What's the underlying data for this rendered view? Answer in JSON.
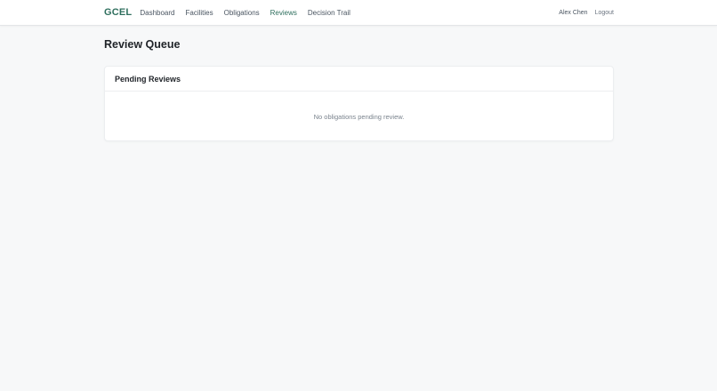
{
  "nav": {
    "brand": "GCEL",
    "links": [
      {
        "label": "Dashboard",
        "active": false
      },
      {
        "label": "Facilities",
        "active": false
      },
      {
        "label": "Obligations",
        "active": false
      },
      {
        "label": "Reviews",
        "active": true
      },
      {
        "label": "Decision Trail",
        "active": false
      }
    ],
    "user_name": "Alex Chen",
    "logout_label": "Logout"
  },
  "page": {
    "title": "Review Queue"
  },
  "pending_card": {
    "title": "Pending Reviews",
    "empty_message": "No obligations pending review."
  },
  "colors": {
    "brand": "#2f6f5e",
    "background": "#f7f8f9",
    "card": "#ffffff"
  }
}
